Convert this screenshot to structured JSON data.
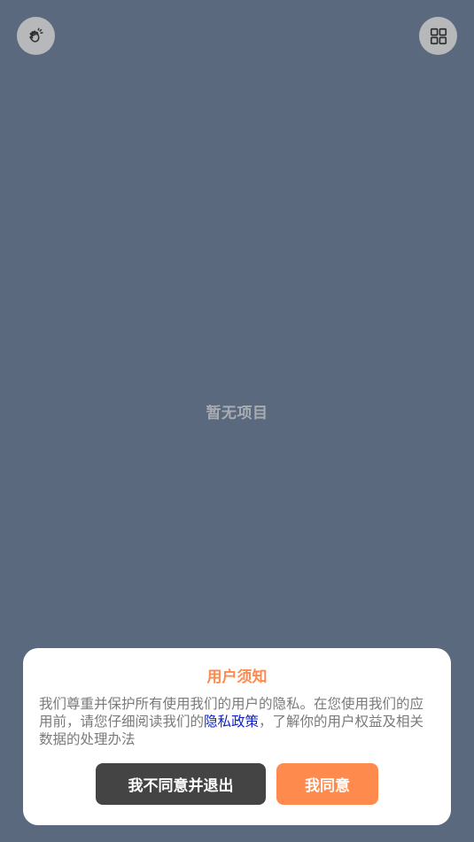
{
  "toolbar": {
    "left_icon": "hand-wave-icon",
    "right_icon": "grid-icon"
  },
  "main": {
    "empty_text": "暂无项目"
  },
  "dialog": {
    "title": "用户须知",
    "body_before_link": "我们尊重并保护所有使用我们的用户的隐私。在您使用我们的应用前，请您仔细阅读我们的",
    "link_text": "隐私政策",
    "body_after_link": "，了解你的用户权益及相关数据的处理办法",
    "decline_label": "我不同意并退出",
    "agree_label": "我同意"
  },
  "colors": {
    "background": "#5a697e",
    "accent": "#ff8a4e",
    "decline_button": "#444444",
    "link": "#0a1fc8",
    "icon_button_bg": "#b7b8ba"
  }
}
